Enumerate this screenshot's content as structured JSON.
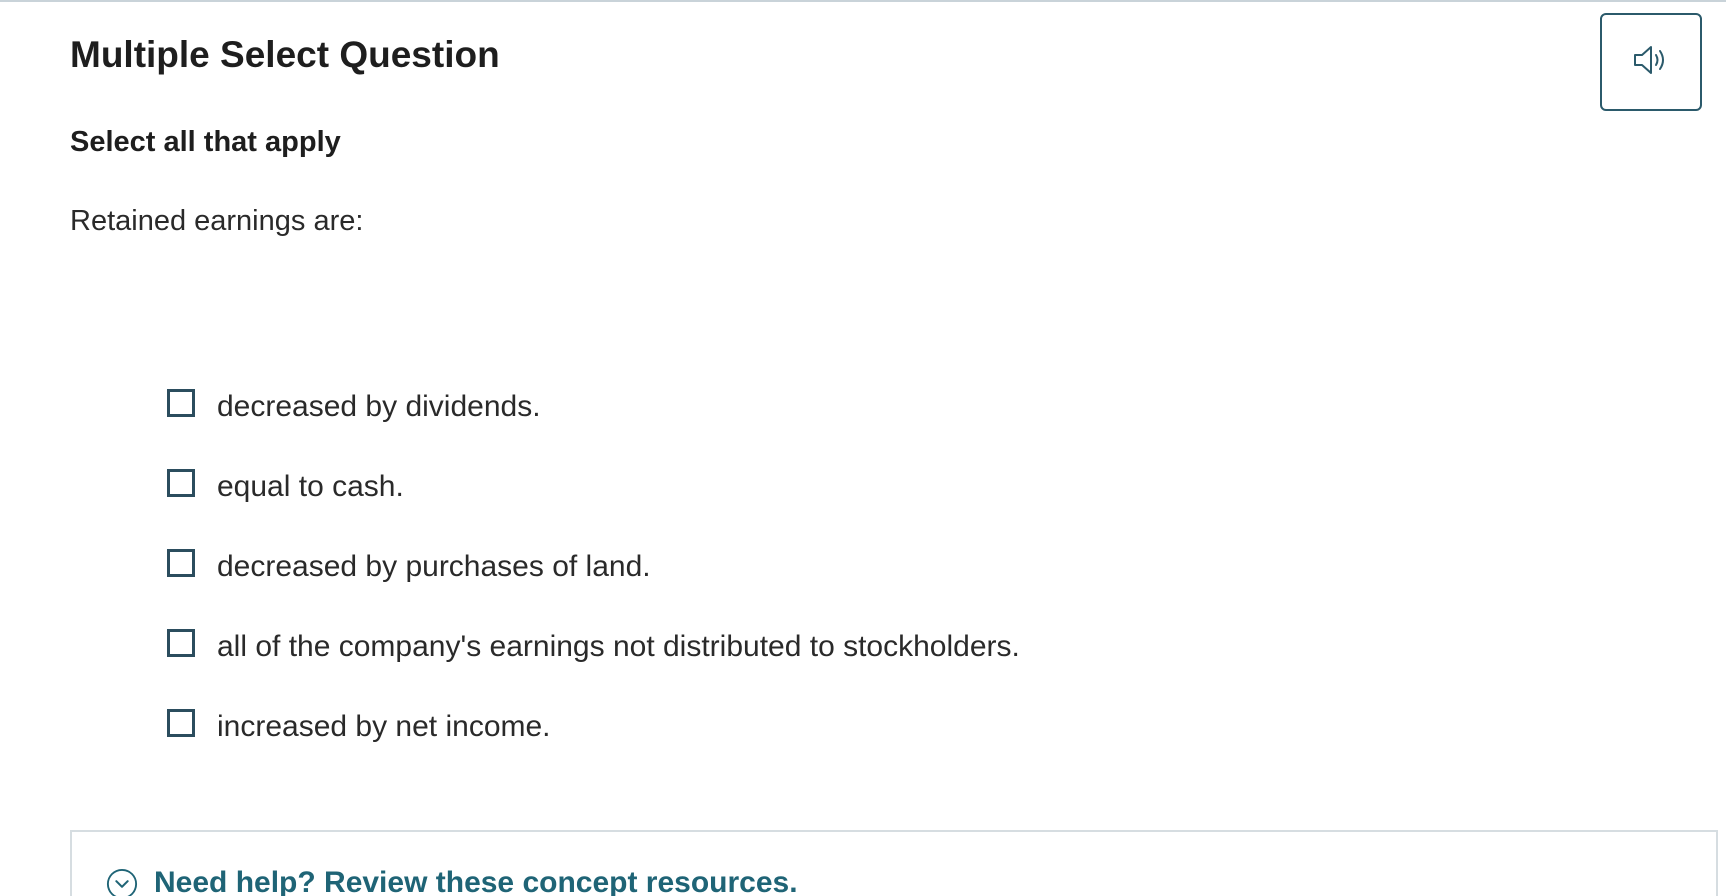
{
  "question": {
    "type_title": "Multiple Select Question",
    "instruction": "Select all that apply",
    "prompt": "Retained earnings are:"
  },
  "audio_button": {
    "icon": "speaker-icon",
    "accent_color": "#2b5a6b"
  },
  "options": [
    {
      "label": "decreased by dividends.",
      "checked": false
    },
    {
      "label": "equal to cash.",
      "checked": false
    },
    {
      "label": "decreased by purchases of land.",
      "checked": false
    },
    {
      "label": "all of the company's earnings not distributed to stockholders.",
      "checked": false
    },
    {
      "label": "increased by net income.",
      "checked": false
    }
  ],
  "help": {
    "icon": "chevron-down-circle-icon",
    "label": "Need help? Review these concept resources.",
    "color": "#1f6476"
  }
}
